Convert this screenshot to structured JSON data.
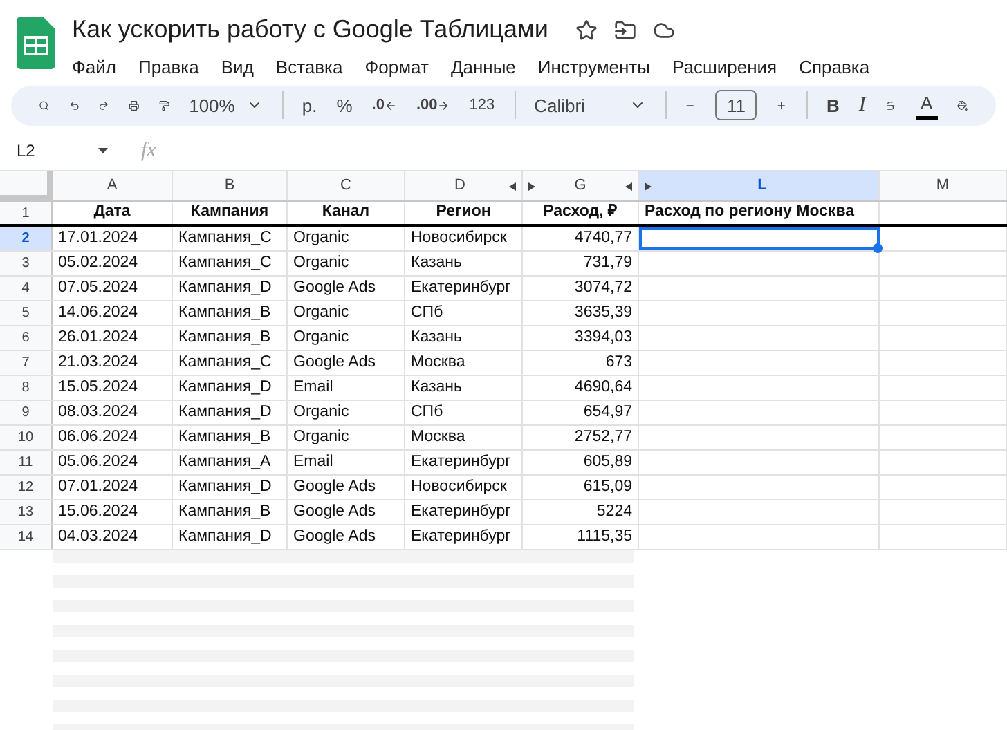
{
  "document": {
    "title": "Как ускорить работу с Google Таблицами",
    "starred": false
  },
  "menu": [
    "Файл",
    "Правка",
    "Вид",
    "Вставка",
    "Формат",
    "Данные",
    "Инструменты",
    "Расширения",
    "Справка"
  ],
  "toolbar": {
    "zoom": "100%",
    "currency": "р.",
    "percent": "%",
    "decrease_decimal": ".0",
    "increase_decimal": ".00",
    "number_format": "123",
    "font": "Calibri",
    "font_size": "11",
    "bold": "B",
    "italic": "I",
    "text_color": "A"
  },
  "name_box": "L2",
  "formula_label": "fx",
  "columns": [
    {
      "letter": "A",
      "selected": false
    },
    {
      "letter": "B",
      "selected": false
    },
    {
      "letter": "C",
      "selected": false
    },
    {
      "letter": "D",
      "selected": false
    },
    {
      "letter": "G",
      "selected": false
    },
    {
      "letter": "L",
      "selected": true
    },
    {
      "letter": "M",
      "selected": false
    }
  ],
  "header_row": {
    "number": "1",
    "selected": false,
    "cells": [
      "Дата",
      "Кампания",
      "Канал",
      "Регион",
      "Расход, ₽",
      "Расход по региону Москва"
    ]
  },
  "rows": [
    {
      "number": "2",
      "selected": true,
      "cells": [
        "17.01.2024",
        "Кампания_C",
        "Organic",
        "Новосибирск",
        "4740,77"
      ]
    },
    {
      "number": "3",
      "selected": false,
      "cells": [
        "05.02.2024",
        "Кампания_C",
        "Organic",
        "Казань",
        "731,79"
      ]
    },
    {
      "number": "4",
      "selected": false,
      "cells": [
        "07.05.2024",
        "Кампания_D",
        "Google Ads",
        "Екатеринбург",
        "3074,72"
      ]
    },
    {
      "number": "5",
      "selected": false,
      "cells": [
        "14.06.2024",
        "Кампания_B",
        "Organic",
        "СПб",
        "3635,39"
      ]
    },
    {
      "number": "6",
      "selected": false,
      "cells": [
        "26.01.2024",
        "Кампания_B",
        "Organic",
        "Казань",
        "3394,03"
      ]
    },
    {
      "number": "7",
      "selected": false,
      "cells": [
        "21.03.2024",
        "Кампания_C",
        "Google Ads",
        "Москва",
        "673"
      ]
    },
    {
      "number": "8",
      "selected": false,
      "cells": [
        "15.05.2024",
        "Кампания_D",
        "Email",
        "Казань",
        "4690,64"
      ]
    },
    {
      "number": "9",
      "selected": false,
      "cells": [
        "08.03.2024",
        "Кампания_D",
        "Organic",
        "СПб",
        "654,97"
      ]
    },
    {
      "number": "10",
      "selected": false,
      "cells": [
        "06.06.2024",
        "Кампания_B",
        "Organic",
        "Москва",
        "2752,77"
      ]
    },
    {
      "number": "11",
      "selected": false,
      "cells": [
        "05.06.2024",
        "Кампания_A",
        "Email",
        "Екатеринбург",
        "605,89"
      ]
    },
    {
      "number": "12",
      "selected": false,
      "cells": [
        "07.01.2024",
        "Кампания_D",
        "Google Ads",
        "Новосибирск",
        "615,09"
      ]
    },
    {
      "number": "13",
      "selected": false,
      "cells": [
        "15.06.2024",
        "Кампания_B",
        "Google Ads",
        "Екатеринбург",
        "5224"
      ]
    },
    {
      "number": "14",
      "selected": false,
      "cells": [
        "04.03.2024",
        "Кампания_D",
        "Google Ads",
        "Екатеринбург",
        "1115,35"
      ]
    }
  ]
}
